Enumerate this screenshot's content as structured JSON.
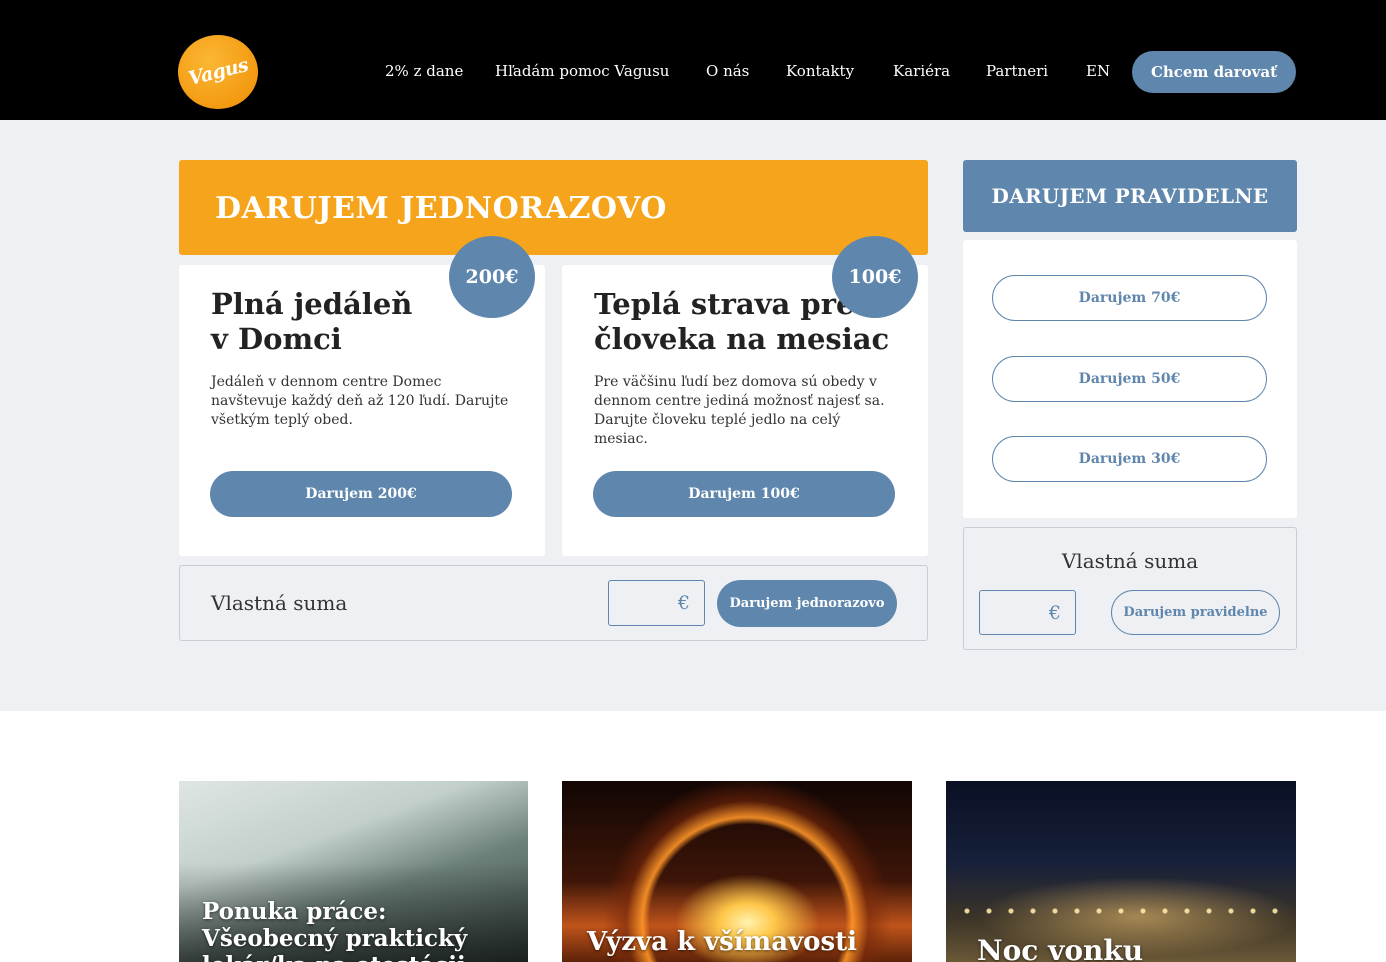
{
  "header": {
    "logo_text": "Vagus",
    "nav": [
      "2% z dane",
      "Hľadám pomoc Vagusu",
      "O nás",
      "Kontakty",
      "Kariéra",
      "Partneri",
      "EN"
    ],
    "cta": "Chcem darovať"
  },
  "once": {
    "title": "DARUJEM JEDNORAZOVO",
    "cards": [
      {
        "badge": "200€",
        "title_line1": "Plná jedáleň",
        "title_line2": "v Domci",
        "text": "Jedáleň v dennom centre Domec navštevuje každý deň až 120 ľudí. Darujte všetkým teplý obed.",
        "button": "Darujem 200€"
      },
      {
        "badge": "100€",
        "title_line1": "Teplá strava pre",
        "title_line2": "človeka na mesiac",
        "text": "Pre väčšinu ľudí bez domova sú obedy v dennom centre jediná možnosť najesť sa. Darujte človeku teplé jedlo na celý mesiac.",
        "button": "Darujem 100€"
      }
    ],
    "custom": {
      "label": "Vlastná suma",
      "currency": "€",
      "button": "Darujem jednorazovo"
    }
  },
  "regular": {
    "title": "DARUJEM PRAVIDELNE",
    "options": [
      "Darujem 70€",
      "Darujem 50€",
      "Darujem 30€"
    ],
    "custom": {
      "label": "Vlastná suma",
      "currency": "€",
      "button": "Darujem pravidelne"
    }
  },
  "news": [
    {
      "line1": "Ponuka práce:",
      "line2": "Všeobecný praktický",
      "line3": "lekár/ka na otestácii"
    },
    {
      "line1": "Výzva k všímavosti"
    },
    {
      "line1": "Noc vonku"
    }
  ]
}
